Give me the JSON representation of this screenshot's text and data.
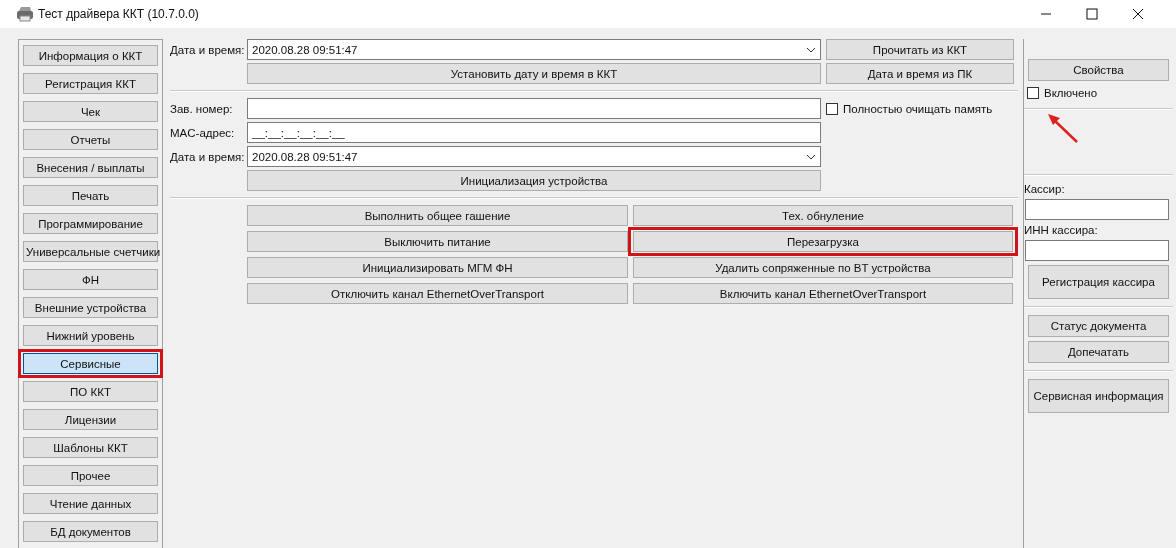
{
  "window": {
    "title": "Тест драйвера ККТ (10.7.0.0)"
  },
  "nav": [
    {
      "label": "Информация о ККТ",
      "selected": false,
      "annotated": false
    },
    {
      "label": "Регистрация ККТ",
      "selected": false,
      "annotated": false
    },
    {
      "label": "Чек",
      "selected": false,
      "annotated": false
    },
    {
      "label": "Отчеты",
      "selected": false,
      "annotated": false
    },
    {
      "label": "Внесения / выплаты",
      "selected": false,
      "annotated": false
    },
    {
      "label": "Печать",
      "selected": false,
      "annotated": false
    },
    {
      "label": "Программирование",
      "selected": false,
      "annotated": false
    },
    {
      "label": "Универсальные счетчики",
      "selected": false,
      "annotated": false
    },
    {
      "label": "ФН",
      "selected": false,
      "annotated": false
    },
    {
      "label": "Внешние устройства",
      "selected": false,
      "annotated": false
    },
    {
      "label": "Нижний уровень",
      "selected": false,
      "annotated": false
    },
    {
      "label": "Сервисные",
      "selected": true,
      "annotated": true
    },
    {
      "label": "ПО ККТ",
      "selected": false,
      "annotated": false
    },
    {
      "label": "Лицензии",
      "selected": false,
      "annotated": false
    },
    {
      "label": "Шаблоны ККТ",
      "selected": false,
      "annotated": false
    },
    {
      "label": "Прочее",
      "selected": false,
      "annotated": false
    },
    {
      "label": "Чтение данных",
      "selected": false,
      "annotated": false
    },
    {
      "label": "БД документов",
      "selected": false,
      "annotated": false
    }
  ],
  "datetime": {
    "label": "Дата и время:",
    "value": "2020.08.28 09:51:47",
    "read_button": "Прочитать из ККТ",
    "set_button": "Установить дату и время в ККТ",
    "pc_button": "Дата и время из ПК"
  },
  "device": {
    "serial": {
      "label": "Зав. номер:"
    },
    "clear_memory": {
      "label": "Полностью очищать память",
      "checked": false
    },
    "mac": {
      "label": "MAC-адрес:",
      "value": "__:__:__:__:__:__"
    },
    "datetime": {
      "label": "Дата и время:",
      "value": "2020.08.28 09:51:47"
    },
    "init_button": "Инициализация устройства"
  },
  "actions": [
    {
      "label": "Выполнить общее гашение",
      "annotated": false
    },
    {
      "label": "Тех. обнуление",
      "annotated": false
    },
    {
      "label": "Выключить питание",
      "annotated": false
    },
    {
      "label": "Перезагрузка",
      "annotated": true
    },
    {
      "label": "Инициализировать МГМ ФН",
      "annotated": false
    },
    {
      "label": "Удалить сопряженные по BT устройства",
      "annotated": false
    },
    {
      "label": "Отключить канал EthernetOverTransport",
      "annotated": false
    },
    {
      "label": "Включить канал EthernetOverTransport",
      "annotated": false
    }
  ],
  "right": {
    "properties_button": "Свойства",
    "enabled": {
      "label": "Включено",
      "checked": false,
      "annotated": true
    },
    "cashier": {
      "label": "Кассир:"
    },
    "cashier_inn": {
      "label": "ИНН кассира:"
    },
    "register_button": "Регистрация кассира",
    "status_button": "Статус документа",
    "reprint_button": "Допечатать",
    "service_button": "Сервисная информация"
  }
}
